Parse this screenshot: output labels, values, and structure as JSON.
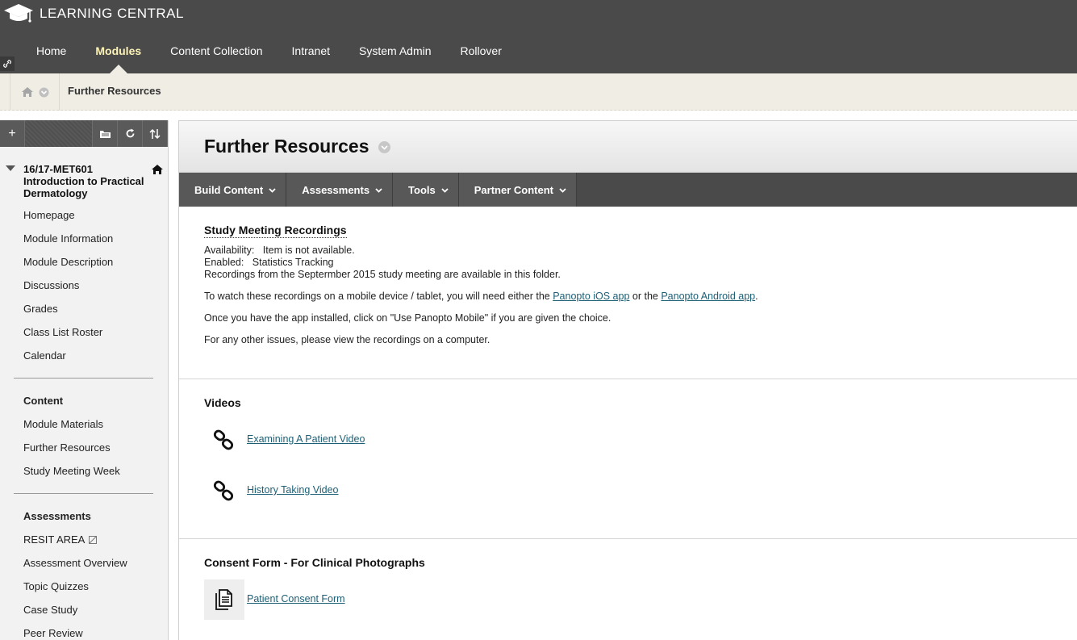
{
  "app": {
    "title": "LEARNING CENTRAL"
  },
  "nav": [
    {
      "label": "Home",
      "active": false
    },
    {
      "label": "Modules",
      "active": true
    },
    {
      "label": "Content Collection",
      "active": false
    },
    {
      "label": "Intranet",
      "active": false
    },
    {
      "label": "System Admin",
      "active": false
    },
    {
      "label": "Rollover",
      "active": false
    }
  ],
  "breadcrumb": {
    "current": "Further Resources"
  },
  "course": {
    "title": "16/17-MET601 Introduction to Practical Dermatology",
    "menu_group1": [
      "Homepage",
      "Module Information",
      "Module Description",
      "Discussions",
      "Grades",
      "Class List Roster",
      "Calendar"
    ],
    "menu_group2_heading": "Content",
    "menu_group2": [
      "Module Materials",
      "Further Resources",
      "Study Meeting Week"
    ],
    "menu_group3_heading": "Assessments",
    "menu_group3": [
      "RESIT AREA",
      "Assessment Overview",
      "Topic Quizzes",
      "Case Study",
      "Peer Review"
    ]
  },
  "page": {
    "title": "Further Resources",
    "actions": [
      "Build Content",
      "Assessments",
      "Tools",
      "Partner Content"
    ]
  },
  "items": {
    "study": {
      "title": "Study Meeting Recordings",
      "availability_label": "Availability:",
      "availability_value": "Item is not available.",
      "enabled_label": "Enabled:",
      "enabled_value": "Statistics Tracking",
      "desc": "Recordings from the Septermber 2015 study meeting are available in this folder.",
      "mobile_pre": "To watch these recordings on a mobile device / tablet, you will need either the ",
      "ios_link": "Panopto iOS app",
      "mobile_mid": " or the ",
      "android_link": "Panopto Android app",
      "mobile_post": ".",
      "app_note": "Once you have the app installed, click on \"Use Panopto Mobile\" if you are given the choice.",
      "other_note": "For any other issues, please view the recordings on a computer."
    },
    "videos": {
      "title": "Videos",
      "links": [
        "Examining A Patient Video",
        "History Taking Video"
      ]
    },
    "consent": {
      "title": "Consent Form - For Clinical Photographs",
      "link": "Patient Consent Form"
    }
  }
}
